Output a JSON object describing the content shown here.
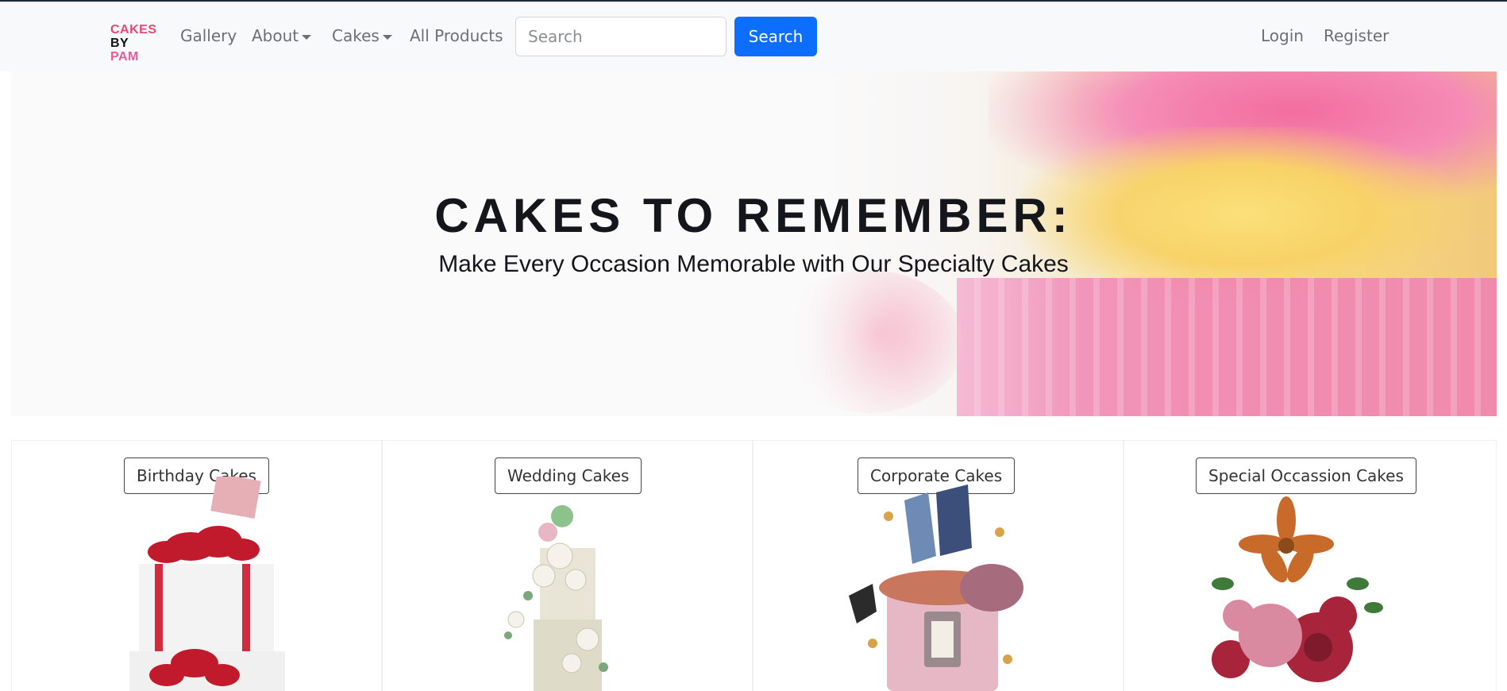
{
  "brand": {
    "line1": "CAKES",
    "line2a": "BY ",
    "line2b": "PAM"
  },
  "nav": {
    "gallery": "Gallery",
    "about": "About",
    "cakes": "Cakes",
    "all_products": "All Products",
    "search_placeholder": "Search",
    "search_button": "Search",
    "login": "Login",
    "register": "Register"
  },
  "hero": {
    "title": "CAKES TO REMEMBER:",
    "subtitle": "Make Every Occasion Memorable with Our Specialty Cakes"
  },
  "categories": [
    {
      "label": "Birthday Cakes",
      "icon": "birthday-cake-image"
    },
    {
      "label": "Wedding Cakes",
      "icon": "wedding-cake-image"
    },
    {
      "label": "Corporate Cakes",
      "icon": "corporate-cake-image"
    },
    {
      "label": "Special Occassion Cakes",
      "icon": "special-occasion-cake-image"
    }
  ],
  "colors": {
    "primary": "#0d6efd",
    "brand_pink": "#e8476f",
    "text_dark": "#15161c"
  }
}
